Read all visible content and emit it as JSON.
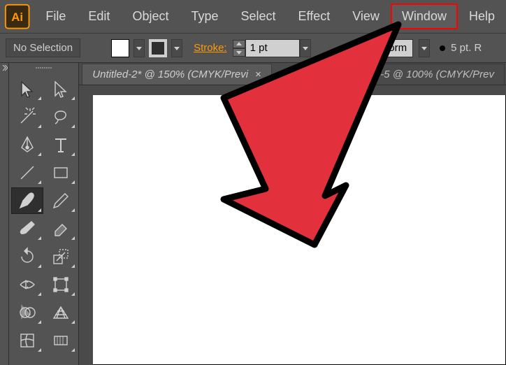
{
  "app": {
    "logo_text": "Ai"
  },
  "menu": {
    "items": [
      "File",
      "Edit",
      "Object",
      "Type",
      "Select",
      "Effect",
      "View",
      "Window",
      "Help"
    ],
    "highlighted_index": 7
  },
  "control_bar": {
    "selection_label": "No Selection",
    "stroke_label": "Stroke:",
    "stroke_value": "1 pt",
    "profile_value": "Uniform",
    "brush_value": "5 pt. R"
  },
  "tabs": {
    "items": [
      {
        "label": "Untitled-2* @ 150% (CMYK/Previ",
        "active": true
      },
      {
        "label": "d-5 @ 100% (CMYK/Prev",
        "active": false
      }
    ]
  },
  "tools": [
    {
      "name": "selection-tool",
      "active": false
    },
    {
      "name": "direct-selection-tool",
      "active": false
    },
    {
      "name": "magic-wand-tool",
      "active": false
    },
    {
      "name": "lasso-tool",
      "active": false
    },
    {
      "name": "pen-tool",
      "active": false
    },
    {
      "name": "type-tool",
      "active": false
    },
    {
      "name": "line-segment-tool",
      "active": false
    },
    {
      "name": "rectangle-tool",
      "active": false
    },
    {
      "name": "paintbrush-tool",
      "active": true
    },
    {
      "name": "pencil-tool",
      "active": false
    },
    {
      "name": "blob-brush-tool",
      "active": false
    },
    {
      "name": "eraser-tool",
      "active": false
    },
    {
      "name": "rotate-tool",
      "active": false
    },
    {
      "name": "scale-tool",
      "active": false
    },
    {
      "name": "width-tool",
      "active": false
    },
    {
      "name": "free-transform-tool",
      "active": false
    },
    {
      "name": "shape-builder-tool",
      "active": false
    },
    {
      "name": "perspective-grid-tool",
      "active": false
    },
    {
      "name": "mesh-tool",
      "active": false
    },
    {
      "name": "gradient-tool",
      "active": false
    }
  ]
}
